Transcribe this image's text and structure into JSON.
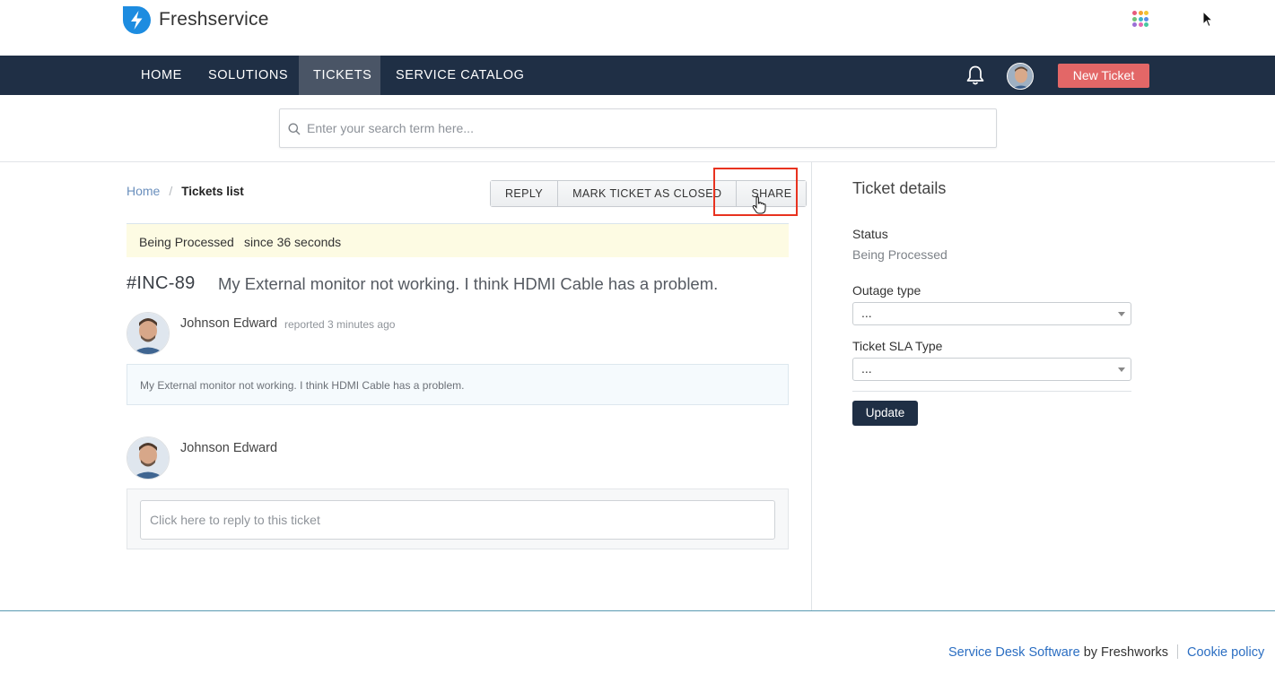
{
  "brand": {
    "name": "Freshservice"
  },
  "nav": {
    "items": [
      {
        "label": "HOME"
      },
      {
        "label": "SOLUTIONS"
      },
      {
        "label": "TICKETS"
      },
      {
        "label": "SERVICE CATALOG"
      }
    ],
    "active": "TICKETS",
    "new_ticket_label": "New Ticket"
  },
  "search": {
    "placeholder": "Enter your search term here..."
  },
  "breadcrumb": {
    "home": "Home",
    "separator": "/",
    "current": "Tickets list"
  },
  "actions": {
    "reply": "REPLY",
    "close": "MARK TICKET AS CLOSED",
    "share": "SHARE"
  },
  "status": {
    "state": "Being Processed",
    "since": "since 36 seconds"
  },
  "ticket": {
    "id": "#INC-89",
    "title": "My External monitor not working. I think HDMI Cable has a problem.",
    "author": "Johnson Edward",
    "reported": "reported 3 minutes ago",
    "message": "My External monitor not working. I think HDMI Cable has a problem."
  },
  "reply": {
    "author": "Johnson Edward",
    "placeholder": "Click here to reply to this ticket"
  },
  "details": {
    "title": "Ticket details",
    "status_label": "Status",
    "status_value": "Being Processed",
    "outage_label": "Outage type",
    "outage_value": "...",
    "sla_label": "Ticket SLA Type",
    "sla_value": "...",
    "update_label": "Update"
  },
  "footer": {
    "link1": "Service Desk Software",
    "by": "by Freshworks",
    "link2": "Cookie policy"
  },
  "colors": {
    "navbar": "#1f2f45",
    "accent_button": "#e36767",
    "highlight": "#e8321f",
    "link": "#2b6ec2"
  }
}
